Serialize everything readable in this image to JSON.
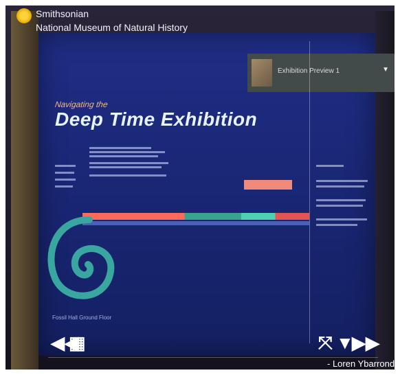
{
  "header": {
    "brand_line1": "Smithsonian",
    "brand_line2": "National Museum of Natural History"
  },
  "scene_selector": {
    "label": "Exhibition Preview 1",
    "icon": "chevron-down-icon"
  },
  "exhibit": {
    "subtitle": "Navigating the",
    "title": "Deep Time Exhibition",
    "caption": "Fossil Hall Ground Floor"
  },
  "controls": {
    "prev_icon": "rewind-icon",
    "grid_icon": "grid-icon",
    "fullscreen_icon": "collapse-icon",
    "menu_icon": "triangle-down-icon",
    "next_icon": "fast-forward-icon"
  },
  "credit": "- Loren Ybarrondo",
  "colors": {
    "panel_blue": "#1f2e86",
    "accent_orange": "#f08a7a",
    "accent_teal": "#3aa38e",
    "logo_yellow": "#ffd23a"
  }
}
